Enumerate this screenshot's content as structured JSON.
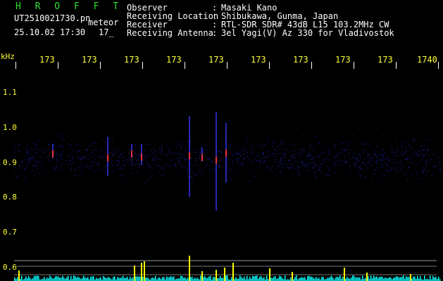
{
  "header": {
    "brand": "H R O F F T",
    "filename": "UT2510021730.pn",
    "tag": "meteor",
    "datetime": "25.10.02 17:30",
    "extra": "17_",
    "fields": [
      {
        "label": "Observer",
        "value": "Masaki Kano"
      },
      {
        "label": "Receiving Location",
        "value": "Shibukawa, Gunma, Japan"
      },
      {
        "label": "Receiver",
        "value": "RTL-SDR SDR# 43dB L15 103.2MHz CW"
      },
      {
        "label": "Receiving Antenna",
        "value": "3el Yagi(V) Az 330 for Vladivostok"
      }
    ],
    "separator": ":"
  },
  "y_axis": {
    "unit": "kHz",
    "labels": [
      "1.1",
      "1.0",
      "0.9",
      "0.8",
      "0.7",
      "0.6"
    ]
  },
  "x_axis": {
    "labels": [
      "173",
      "173",
      "173",
      "173",
      "173",
      "173",
      "173",
      "173",
      "173",
      "1740"
    ]
  },
  "colors": {
    "background": "#000000",
    "text": "#ffffff",
    "axis_text": "#ffff33",
    "brand": "#2fe02f",
    "noise": "#1a1a8c",
    "strong": "#ff3030",
    "level": "#ffff00",
    "baseline": "#00ffff"
  }
}
